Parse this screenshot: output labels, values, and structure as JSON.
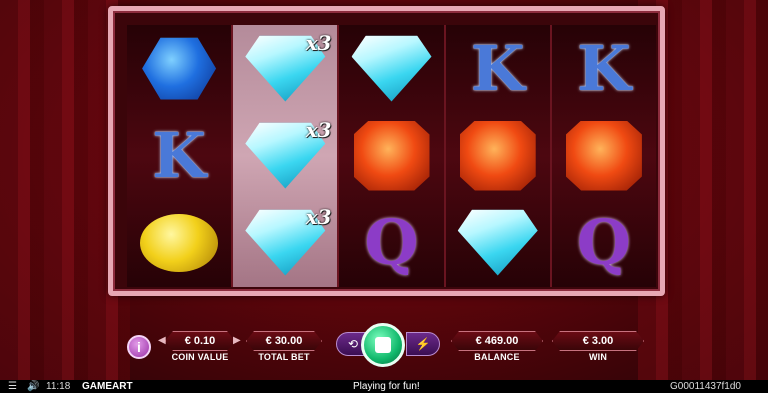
{
  "game": {
    "reels": [
      {
        "highlight": false,
        "symbols": [
          {
            "kind": "gem-blue",
            "label": ""
          },
          {
            "kind": "letter-k",
            "label": "K"
          },
          {
            "kind": "gem-yellow",
            "label": ""
          }
        ]
      },
      {
        "highlight": true,
        "symbols": [
          {
            "kind": "diamond",
            "label": "",
            "mult": "x3"
          },
          {
            "kind": "diamond",
            "label": "",
            "mult": "x3"
          },
          {
            "kind": "diamond",
            "label": "",
            "mult": "x3"
          }
        ]
      },
      {
        "highlight": false,
        "symbols": [
          {
            "kind": "diamond",
            "label": ""
          },
          {
            "kind": "gem-red",
            "label": ""
          },
          {
            "kind": "letter-q",
            "label": "Q"
          }
        ]
      },
      {
        "highlight": false,
        "symbols": [
          {
            "kind": "letter-k",
            "label": "K"
          },
          {
            "kind": "gem-red",
            "label": ""
          },
          {
            "kind": "diamond",
            "label": ""
          }
        ]
      },
      {
        "highlight": false,
        "symbols": [
          {
            "kind": "letter-k",
            "label": "K"
          },
          {
            "kind": "gem-red",
            "label": ""
          },
          {
            "kind": "letter-q",
            "label": "Q"
          }
        ]
      }
    ]
  },
  "controls": {
    "info_icon": "i",
    "coin_value": "€ 0.10",
    "coin_value_label": "COIN VALUE",
    "total_bet": "€ 30.00",
    "total_bet_label": "TOTAL BET",
    "balance": "€ 469.00",
    "balance_label": "BALANCE",
    "win": "€ 3.00",
    "win_label": "WIN",
    "spin_icon": "stop-icon",
    "autoplay_icon": "autoplay-icon",
    "turbo_icon": "lightning-icon"
  },
  "footer": {
    "time": "11:18",
    "brand": "GAMEART",
    "status": "Playing for fun!",
    "round_id": "G00011437f1d0"
  },
  "colors": {
    "background": "#5c050b",
    "frame": "#e7a8b4",
    "spin": "#10b86b"
  }
}
